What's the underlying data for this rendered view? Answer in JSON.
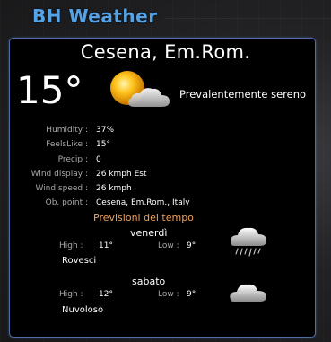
{
  "app": {
    "title": "BH Weather"
  },
  "current": {
    "city": "Cesena, Em.Rom.",
    "temperature": "15°",
    "condition": "Prevalentemente sereno",
    "icon": "sun-behind-cloud-icon"
  },
  "details": [
    {
      "label": "Humidity :",
      "value": "37%"
    },
    {
      "label": "FeelsLike :",
      "value": "15°"
    },
    {
      "label": "Precip :",
      "value": "0"
    },
    {
      "label": "Wind display :",
      "value": "26 kmph Est"
    },
    {
      "label": "Wind speed :",
      "value": "26 kmph"
    },
    {
      "label": "Ob. point :",
      "value": "Cesena, Em.Rom., Italy"
    }
  ],
  "forecast": {
    "heading": "Previsioni del tempo",
    "days": [
      {
        "day": "venerdì",
        "high_label": "High :",
        "high": "11°",
        "low_label": "Low :",
        "low": "9°",
        "description": "Rovesci",
        "icon": "rain-cloud-icon"
      },
      {
        "day": "sabato",
        "high_label": "High :",
        "high": "12°",
        "low_label": "Low :",
        "low": "9°",
        "description": "Nuvoloso",
        "icon": "cloud-icon"
      }
    ]
  },
  "colors": {
    "title": "#55a3e6",
    "panel_border": "#4d6ea3",
    "forecast_heading": "#f0a15a",
    "label": "#a8a8a8"
  }
}
